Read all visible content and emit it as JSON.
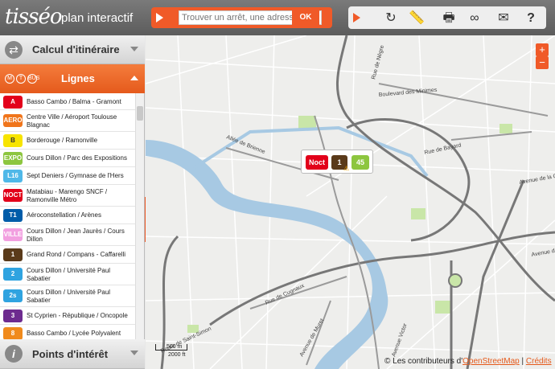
{
  "header": {
    "logo": "tisséo",
    "subtitle": "plan interactif",
    "search_placeholder": "Trouver un arrêt, une adresse",
    "ok_label": "OK",
    "tools": [
      "refresh-icon",
      "ruler-icon",
      "printer-icon",
      "link-icon",
      "mail-icon",
      "help-icon"
    ]
  },
  "sidebar": {
    "calc_label": "Calcul d'itinéraire",
    "lignes_label": "Lignes",
    "lignes_modes": [
      "M",
      "T",
      "BUS"
    ],
    "points_label": "Points d'intérêt",
    "lines": [
      {
        "code": "A",
        "name": "Basso Cambo / Balma - Gramont",
        "color": "#e3001b"
      },
      {
        "code": "AERO",
        "name": "Centre Ville / Aéroport Toulouse Blagnac",
        "color": "#f0751b"
      },
      {
        "code": "B",
        "name": "Borderouge / Ramonville",
        "color": "#f7e400"
      },
      {
        "code": "EXPO",
        "name": "Cours Dillon / Parc des Expositions",
        "color": "#8dc63f"
      },
      {
        "code": "L16",
        "name": "Sept Deniers / Gymnase de l'Hers",
        "color": "#4fb8e8"
      },
      {
        "code": "NOCT",
        "name": "Matabiau - Marengo SNCF / Ramonville Métro",
        "color": "#e2001a"
      },
      {
        "code": "T1",
        "name": "Aéroconstellation / Arènes",
        "color": "#005ca9"
      },
      {
        "code": "VILLE",
        "name": "Cours Dillon / Jean Jaurès / Cours Dillon",
        "color": "#f29fe0"
      },
      {
        "code": "1",
        "name": "Grand Rond / Compans - Caffarelli",
        "color": "#5a3a1a"
      },
      {
        "code": "2",
        "name": "Cours Dillon / Université Paul Sabatier",
        "color": "#2fa3e0"
      },
      {
        "code": "2s",
        "name": "Cours Dillon / Université Paul Sabatier",
        "color": "#2fa3e0"
      },
      {
        "code": "3",
        "name": "St Cyprien - République / Oncopole",
        "color": "#6d2b8f"
      },
      {
        "code": "8",
        "name": "Basso Cambo / Lycée Polyvalent",
        "color": "#f08a1c"
      }
    ]
  },
  "map": {
    "popup_badges": [
      {
        "label": "Noct",
        "color": "#e2001a"
      },
      {
        "label": "1",
        "color": "#5a3a1a"
      },
      {
        "label": "45",
        "color": "#8dc63f"
      }
    ],
    "streets": [
      "Rue de Nègre",
      "Boulevard des Minimes",
      "Rue de Bayard",
      "Allée de Brienne",
      "Avenue de la C",
      "Avenue de la",
      "Rue de Cugnaux",
      "Avenue de Muret",
      "Route de Saint-Simon",
      "Avenue Victor"
    ],
    "scale_m": "500 m",
    "scale_ft": "2000 ft",
    "attribution_prefix": "© Les contributeurs d'",
    "attribution_link": "OpenStreetMap",
    "attribution_sep": "|",
    "credits": "Crédits",
    "zoom_in": "+",
    "zoom_out": "−"
  }
}
